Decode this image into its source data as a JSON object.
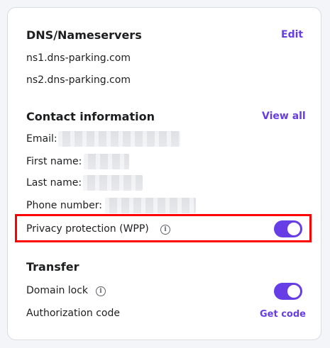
{
  "dns": {
    "title": "DNS/Nameservers",
    "edit_label": "Edit",
    "nameservers": [
      "ns1.dns-parking.com",
      "ns2.dns-parking.com"
    ]
  },
  "contact": {
    "title": "Contact information",
    "view_all_label": "View all",
    "email_label": "Email:",
    "first_name_label": "First name:",
    "last_name_label": "Last name:",
    "phone_label": "Phone number:"
  },
  "privacy": {
    "label": "Privacy protection (WPP)",
    "enabled": true
  },
  "transfer": {
    "title": "Transfer",
    "domain_lock_label": "Domain lock",
    "domain_lock_enabled": true,
    "auth_code_label": "Authorization code",
    "get_code_label": "Get code"
  },
  "icons": {
    "info": "info-icon"
  },
  "colors": {
    "accent": "#673de6",
    "highlight": "#ff0000",
    "text": "#1d1e20"
  }
}
